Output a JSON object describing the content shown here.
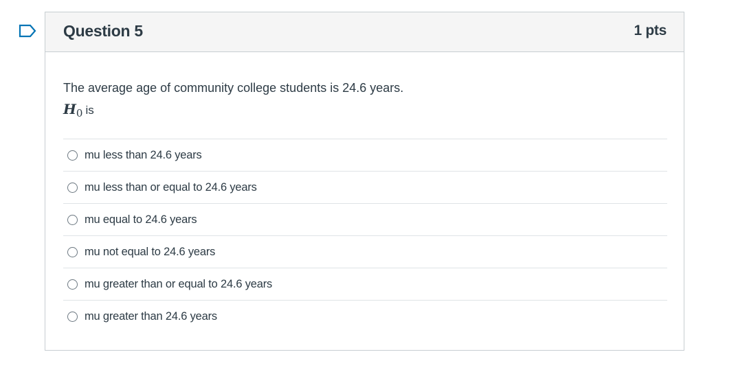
{
  "question": {
    "title": "Question 5",
    "points": "1 pts",
    "text": "The average age of community college students is 24.6 years.",
    "math_symbol": "H",
    "math_subscript": "0",
    "math_rest": "is"
  },
  "answers": [
    {
      "label": "mu less than 24.6 years",
      "selected": false
    },
    {
      "label": "mu less than or equal to 24.6 years",
      "selected": false
    },
    {
      "label": "mu equal to 24.6 years",
      "selected": false
    },
    {
      "label": "mu not equal to 24.6 years",
      "selected": false
    },
    {
      "label": "mu greater than or equal to 24.6 years",
      "selected": false
    },
    {
      "label": "mu greater than 24.6 years",
      "selected": false
    }
  ],
  "colors": {
    "flag": "#0374b5",
    "text": "#2d3b45",
    "header_bg": "#f5f5f5",
    "border": "#c7cdd1"
  },
  "icons": {
    "flag": "flag-icon"
  }
}
